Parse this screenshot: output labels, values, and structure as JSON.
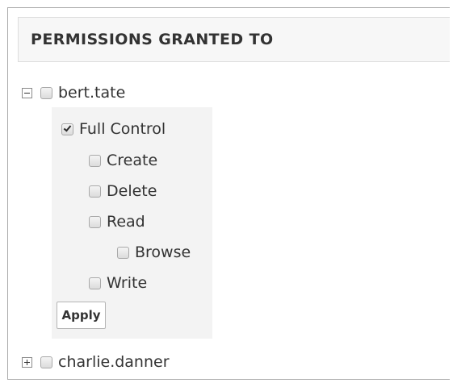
{
  "header": {
    "title": "PERMISSIONS GRANTED TO"
  },
  "users": [
    {
      "name": "bert.tate",
      "expanded": true,
      "toggle_icon": "minus-icon",
      "checked": false,
      "permissions": [
        {
          "label": "Full Control",
          "checked": true
        },
        {
          "label": "Create",
          "checked": false
        },
        {
          "label": "Delete",
          "checked": false
        },
        {
          "label": "Read",
          "checked": false
        },
        {
          "label": "Browse",
          "checked": false
        },
        {
          "label": "Write",
          "checked": false
        }
      ],
      "apply_label": "Apply"
    },
    {
      "name": "charlie.danner",
      "expanded": false,
      "toggle_icon": "plus-icon",
      "checked": false
    }
  ]
}
